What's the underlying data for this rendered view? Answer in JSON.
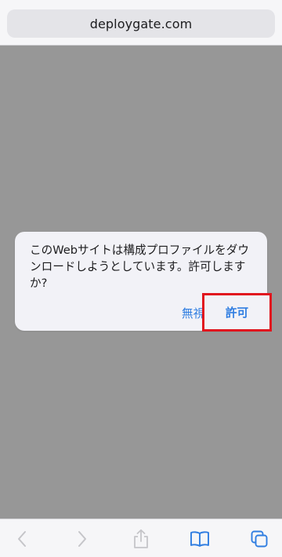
{
  "browser": {
    "url": "deploygate.com"
  },
  "alert": {
    "message": "このWebサイトは構成プロファイルをダウンロードしようとしています。許可しますか?",
    "ignore_label": "無視",
    "allow_label": "許可"
  },
  "toolbar": {
    "icons": [
      "back-icon",
      "forward-icon",
      "share-icon",
      "bookmarks-icon",
      "tabs-icon"
    ],
    "colors": {
      "enabled": "#2f7de1",
      "disabled": "#c5c5c9"
    }
  },
  "colors": {
    "dim_overlay": "#979797",
    "highlight": "#e1151e",
    "accent": "#2f7de1"
  }
}
